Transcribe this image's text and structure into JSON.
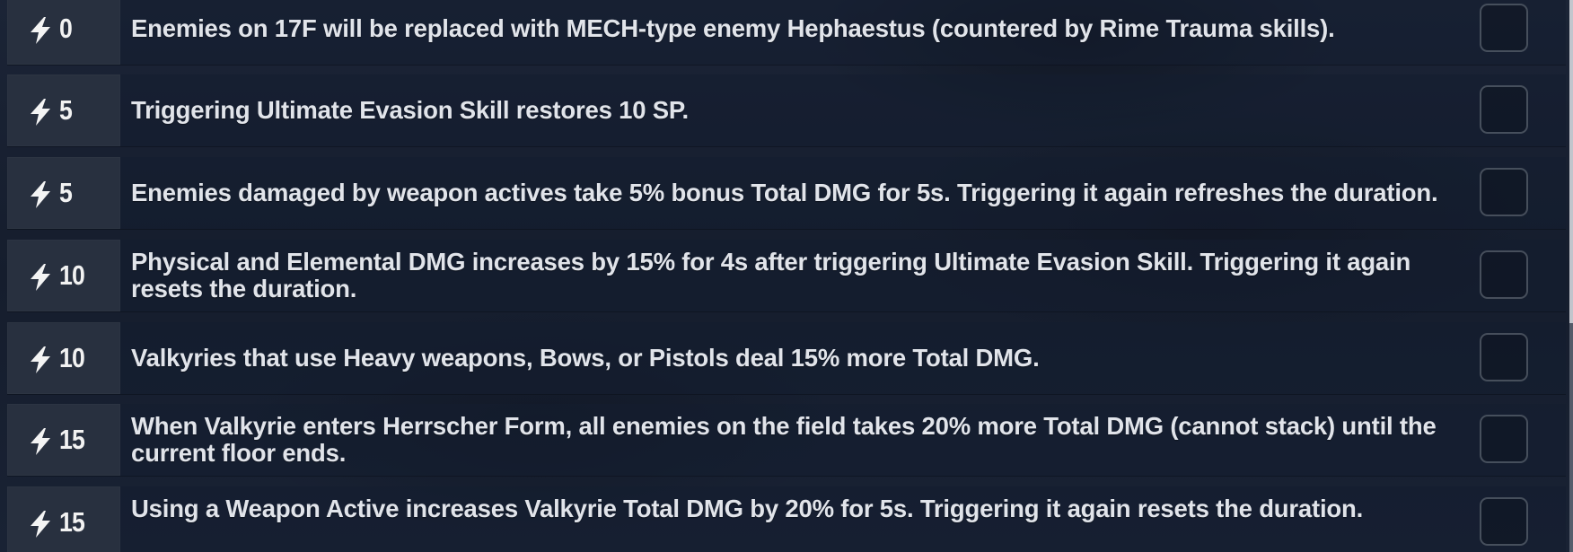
{
  "buffs": [
    {
      "cost": "0",
      "text": "Enemies on 17F will be replaced with MECH-type enemy Hephaestus (countered by Rime Trauma skills)."
    },
    {
      "cost": "5",
      "text": "Triggering Ultimate Evasion Skill restores 10 SP."
    },
    {
      "cost": "5",
      "text": "Enemies damaged by weapon actives take 5% bonus Total DMG for 5s. Triggering it again refreshes the duration."
    },
    {
      "cost": "10",
      "text": "Physical and Elemental DMG increases by 15% for 4s after triggering Ultimate Evasion Skill. Triggering it again resets the duration."
    },
    {
      "cost": "10",
      "text": "Valkyries that use Heavy weapons, Bows, or Pistols deal 15% more Total DMG."
    },
    {
      "cost": "15",
      "text": "When Valkyrie enters Herrscher Form, all enemies on the field takes 20% more Total DMG (cannot stack) until the current floor ends."
    },
    {
      "cost": "15",
      "text": "Using a Weapon Active increases Valkyrie Total DMG by 20% for 5s. Triggering it again resets the duration."
    }
  ],
  "icons": {
    "cost_icon": "lightning-bolt-icon",
    "select_icon": "checkbox-icon"
  },
  "colors": {
    "background": "#141c2b",
    "cost_box": "#2c3442",
    "text": "#e1e4ea",
    "checkbox_border": "#5a626e"
  }
}
